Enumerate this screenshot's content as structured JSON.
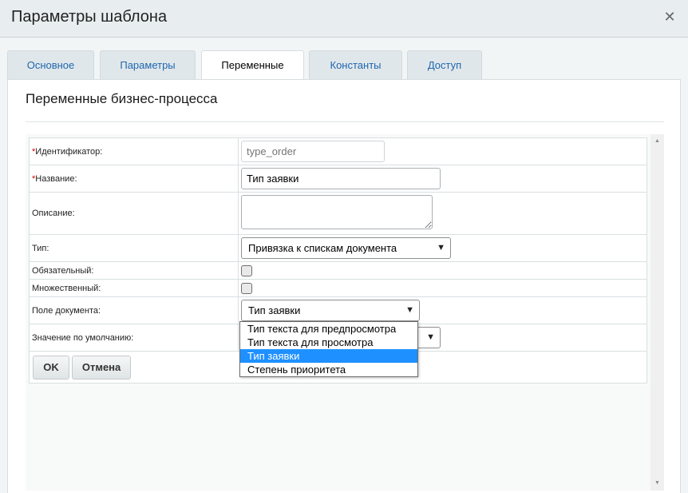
{
  "window": {
    "title": "Параметры шаблона",
    "close_icon": "close-icon"
  },
  "tabs": [
    {
      "label": "Основное",
      "active": false
    },
    {
      "label": "Параметры",
      "active": false
    },
    {
      "label": "Переменные",
      "active": true
    },
    {
      "label": "Константы",
      "active": false
    },
    {
      "label": "Доступ",
      "active": false
    }
  ],
  "panel": {
    "title": "Переменные бизнес-процесса"
  },
  "form": {
    "identifier": {
      "label": "Идентификатор:",
      "required_mark": "*",
      "placeholder": "type_order"
    },
    "name": {
      "label": "Название:",
      "required_mark": "*",
      "value": "Тип заявки"
    },
    "description": {
      "label": "Описание:",
      "value": ""
    },
    "type": {
      "label": "Тип:",
      "value": "Привязка к спискам документа"
    },
    "required": {
      "label": "Обязательный:",
      "checked": false
    },
    "multiple": {
      "label": "Множественный:",
      "checked": false
    },
    "document_field": {
      "label": "Поле документа:",
      "value": "Тип заявки",
      "options": [
        "Тип текста для предпросмотра",
        "Тип текста для просмотра",
        "Тип заявки",
        "Степень приоритета"
      ],
      "selected_index": 2
    },
    "default_value": {
      "label": "Значение по умолчанию:"
    }
  },
  "buttons": {
    "ok": "OK",
    "cancel": "Отмена"
  },
  "colors": {
    "accent_tab_text": "#2067b0",
    "selected_option": "#1e90ff",
    "required_mark": "#d40000"
  }
}
